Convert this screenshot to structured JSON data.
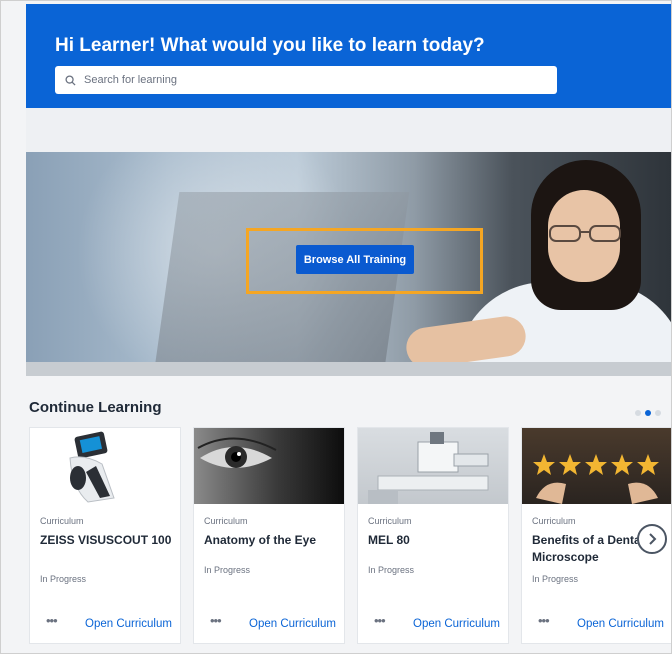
{
  "header": {
    "greeting": "Hi Learner! What would you like to learn today?",
    "search_placeholder": "Search for learning",
    "search_icon": "search-icon"
  },
  "hero": {
    "button_label": "Browse All Training"
  },
  "continue_learning": {
    "title": "Continue Learning",
    "cards": [
      {
        "kind": "Curriculum",
        "name": "ZEISS VISUSCOUT 100",
        "status": "In Progress",
        "more": "•••",
        "action": "Open Curriculum"
      },
      {
        "kind": "Curriculum",
        "name": "Anatomy of the Eye",
        "status": "In Progress",
        "more": "•••",
        "action": "Open Curriculum"
      },
      {
        "kind": "Curriculum",
        "name": "MEL 80",
        "status": "In Progress",
        "more": "•••",
        "action": "Open Curriculum"
      },
      {
        "kind": "Curriculum",
        "name": "Benefits of a Dental Microscope",
        "status": "In Progress",
        "more": "•••",
        "action": "Open Curriculum"
      }
    ],
    "page_count": 3,
    "active_page": 2
  },
  "colors": {
    "brand": "#0a64d6",
    "highlight": "#f5a623"
  }
}
